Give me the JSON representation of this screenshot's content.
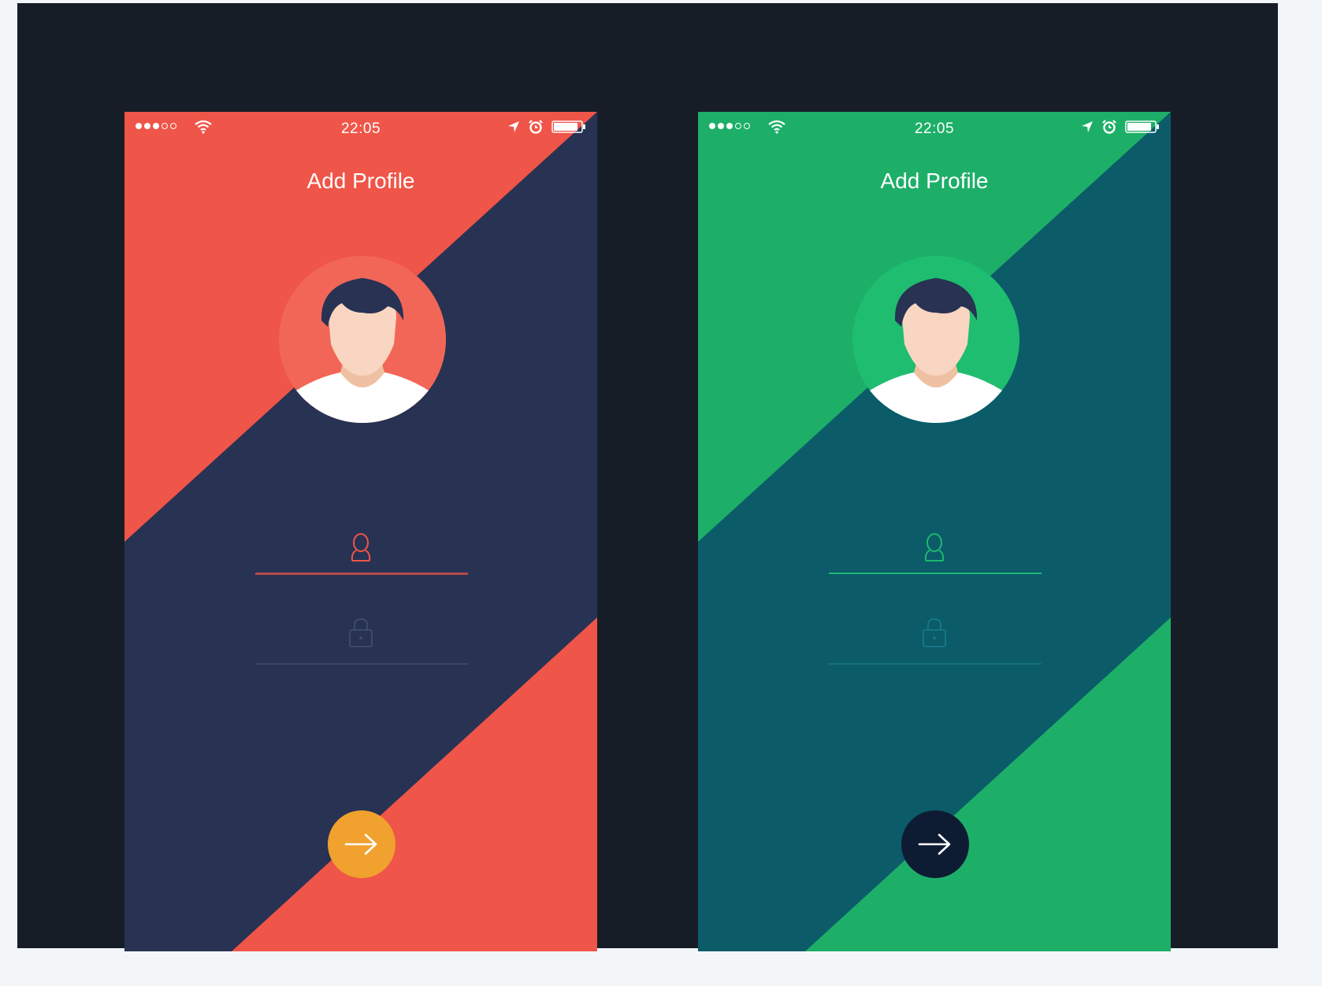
{
  "screens": [
    {
      "variant": "red",
      "status": {
        "time": "22:05",
        "signal_bars": 3,
        "signal_total": 5
      },
      "title": "Add Profile",
      "icons": [
        "wifi-icon",
        "location-arrow-icon",
        "alarm-icon",
        "battery-icon",
        "user-icon",
        "lock-icon",
        "arrow-right-icon"
      ],
      "colors": {
        "accent": "#ef5548",
        "dark": "#283253",
        "avatar_bg": "#f26657",
        "user_line": "#b8484a",
        "pass_line": "#3a4668",
        "pass_icon": "#3d4a6c",
        "button": "#f0a12e"
      }
    },
    {
      "variant": "green",
      "status": {
        "time": "22:05",
        "signal_bars": 3,
        "signal_total": 5
      },
      "title": "Add Profile",
      "icons": [
        "wifi-icon",
        "location-arrow-icon",
        "alarm-icon",
        "battery-icon",
        "user-icon",
        "lock-icon",
        "arrow-right-icon"
      ],
      "colors": {
        "accent": "#1daf68",
        "dark": "#0b5b69",
        "avatar_bg": "#1fbd70",
        "user_line": "#1eb86f",
        "pass_line": "#15707d",
        "pass_icon": "#167585",
        "button": "#0e1c33"
      }
    }
  ]
}
